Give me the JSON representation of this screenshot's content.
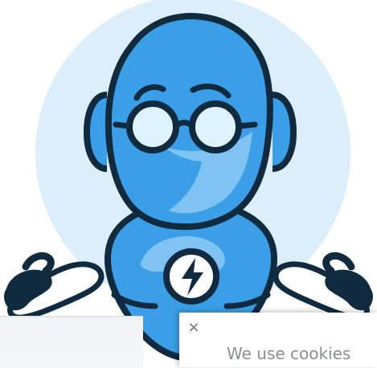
{
  "mascot": {
    "icon": "robot-with-glasses",
    "badge_icon": "lightning-bolt-icon",
    "colors": {
      "halo": "#dceefa",
      "body_blue": "#3b9fe7",
      "light_blue": "#7fc3f3",
      "outline": "#102b3f",
      "white": "#ffffff"
    }
  },
  "cookie_banner": {
    "close_symbol": "×",
    "message": "We use cookies"
  }
}
